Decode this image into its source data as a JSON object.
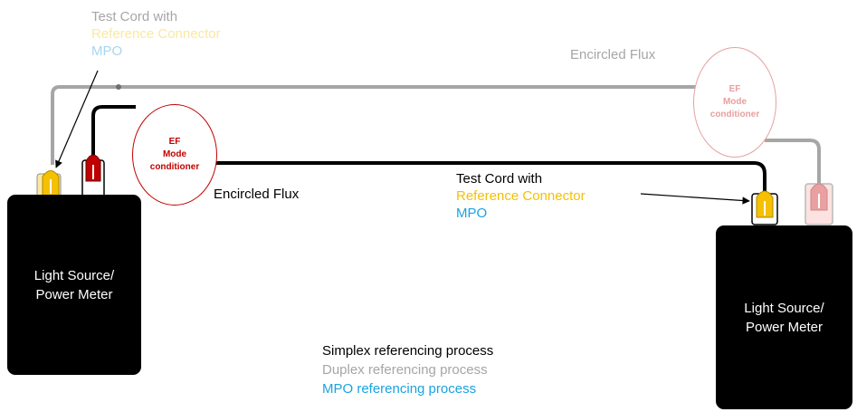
{
  "colors": {
    "simplex": "#000000",
    "duplex": "#a6a6a6",
    "mpo": "#1aa3e0",
    "reference": "#f5c000",
    "reference_light": "#fbe8a0",
    "mpo_light": "#a9d6ee",
    "ef_dark": "#c00000",
    "ef_light": "#e6a0a0"
  },
  "left_unit": {
    "label": "Light Source/\nPower Meter"
  },
  "right_unit": {
    "label": "Light Source/\nPower Meter"
  },
  "ef_left": {
    "label": "EF\nMode\nconditioner"
  },
  "ef_right": {
    "label": "EF\nMode\nconditioner"
  },
  "top_label": {
    "line1": "Test Cord with",
    "line2": "Reference Connector",
    "line3": "MPO"
  },
  "mid_label": {
    "line1": "Test Cord with",
    "line2": "Reference Connector",
    "line3": "MPO"
  },
  "encircled_flux_top": "Encircled Flux",
  "encircled_flux_mid": "Encircled Flux",
  "legend": {
    "simplex": "Simplex referencing process",
    "duplex": "Duplex referencing process",
    "mpo": "MPO referencing process"
  }
}
